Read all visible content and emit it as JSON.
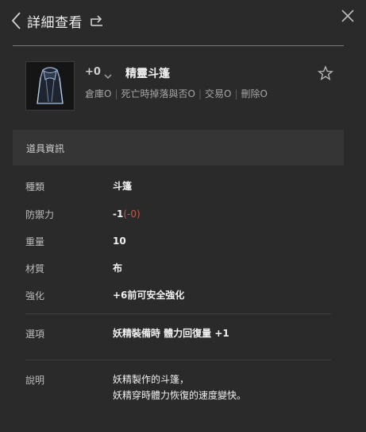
{
  "header": {
    "title": "詳細查看",
    "back_icon": "chevron-left-icon",
    "share_icon": "share-icon",
    "close_icon": "close-icon"
  },
  "item": {
    "enhance_level": "+0",
    "name": "精靈斗篷",
    "thumbnail_icon": "cloak-icon",
    "flags": [
      "倉庫O",
      "死亡時掉落與否O",
      "交易O",
      "刪除O"
    ]
  },
  "section": {
    "title": "道具資訊"
  },
  "info": {
    "type": {
      "label": "種類",
      "value": "斗篷"
    },
    "defense": {
      "label": "防禦力",
      "value": "-1",
      "extra": "(-0)"
    },
    "weight": {
      "label": "重量",
      "value": "10"
    },
    "material": {
      "label": "材質",
      "value": "布"
    },
    "enchant": {
      "label": "強化",
      "value": "+6前可安全強化"
    },
    "option": {
      "label": "選項",
      "value": "妖精裝備時 體力回復量 +1"
    },
    "desc": {
      "label": "說明",
      "line1": "妖精製作的斗篷，",
      "line2": "妖精穿時體力恢復的速度變快。"
    }
  },
  "colors": {
    "background": "#2a2a2a",
    "section_bar": "#353535",
    "accent_red": "#c15a50"
  }
}
